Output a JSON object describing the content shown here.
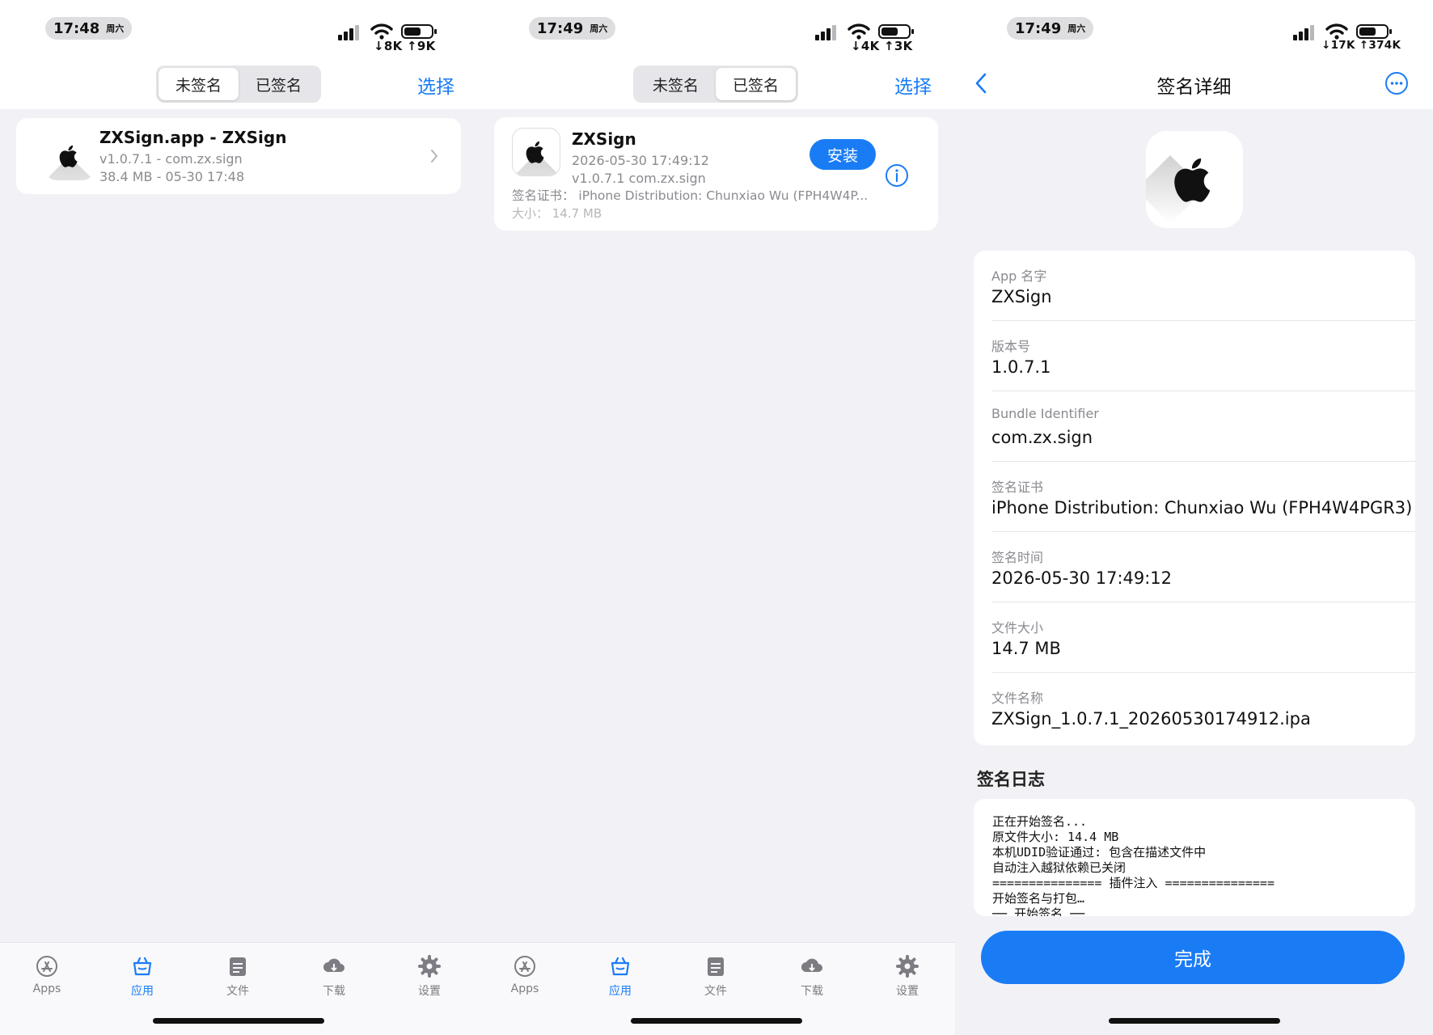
{
  "colors": {
    "accent": "#1a7cf5",
    "background": "#f2f2f6"
  },
  "screen1": {
    "time": "17:48",
    "weekday": "周六",
    "speed": "↓8K ↑9K",
    "seg_unsigned": "未签名",
    "seg_signed": "已签名",
    "select": "选择",
    "item": {
      "title": "ZXSign.app - ZXSign",
      "subtitle": "v1.0.7.1 - com.zx.sign",
      "meta": "38.4 MB - 05-30 17:48"
    }
  },
  "screen2": {
    "time": "17:49",
    "weekday": "周六",
    "speed": "↓4K ↑3K",
    "seg_unsigned": "未签名",
    "seg_signed": "已签名",
    "select": "选择",
    "item": {
      "name": "ZXSign",
      "date": "2026-05-30 17:49:12",
      "version": "v1.0.7.1  com.zx.sign",
      "cert": "签名证书： iPhone Distribution: Chunxiao Wu (FPH4W4P...",
      "size": "大小： 14.7 MB",
      "install": "安装"
    }
  },
  "screen3": {
    "time": "17:49",
    "weekday": "周六",
    "speed": "↓17K ↑374K",
    "title": "签名详细",
    "fields": [
      {
        "label": "App 名字",
        "value": "ZXSign"
      },
      {
        "label": "版本号",
        "value": "1.0.7.1"
      },
      {
        "label": "Bundle Identifier",
        "value": "com.zx.sign"
      },
      {
        "label": "签名证书",
        "value": "iPhone Distribution: Chunxiao Wu (FPH4W4PGR3)"
      },
      {
        "label": "签名时间",
        "value": "2026-05-30 17:49:12"
      },
      {
        "label": "文件大小",
        "value": "14.7 MB"
      },
      {
        "label": "文件名称",
        "value": "ZXSign_1.0.7.1_20260530174912.ipa"
      }
    ],
    "log_title": "签名日志",
    "log": [
      "正在开始签名...",
      "原文件大小: 14.4 MB",
      "本机UDID验证通过: 包含在描述文件中",
      "自动注入越狱依赖已关闭",
      "=============== 插件注入 ===============",
      "开始签名与打包…",
      "── 开始签名 ──"
    ],
    "done": "完成"
  },
  "tabs": [
    {
      "label": "Apps",
      "icon": "app-store-icon"
    },
    {
      "label": "应用",
      "icon": "apps-box-icon"
    },
    {
      "label": "文件",
      "icon": "folder-icon"
    },
    {
      "label": "下载",
      "icon": "cloud-download-icon"
    },
    {
      "label": "设置",
      "icon": "gear-icon"
    }
  ]
}
